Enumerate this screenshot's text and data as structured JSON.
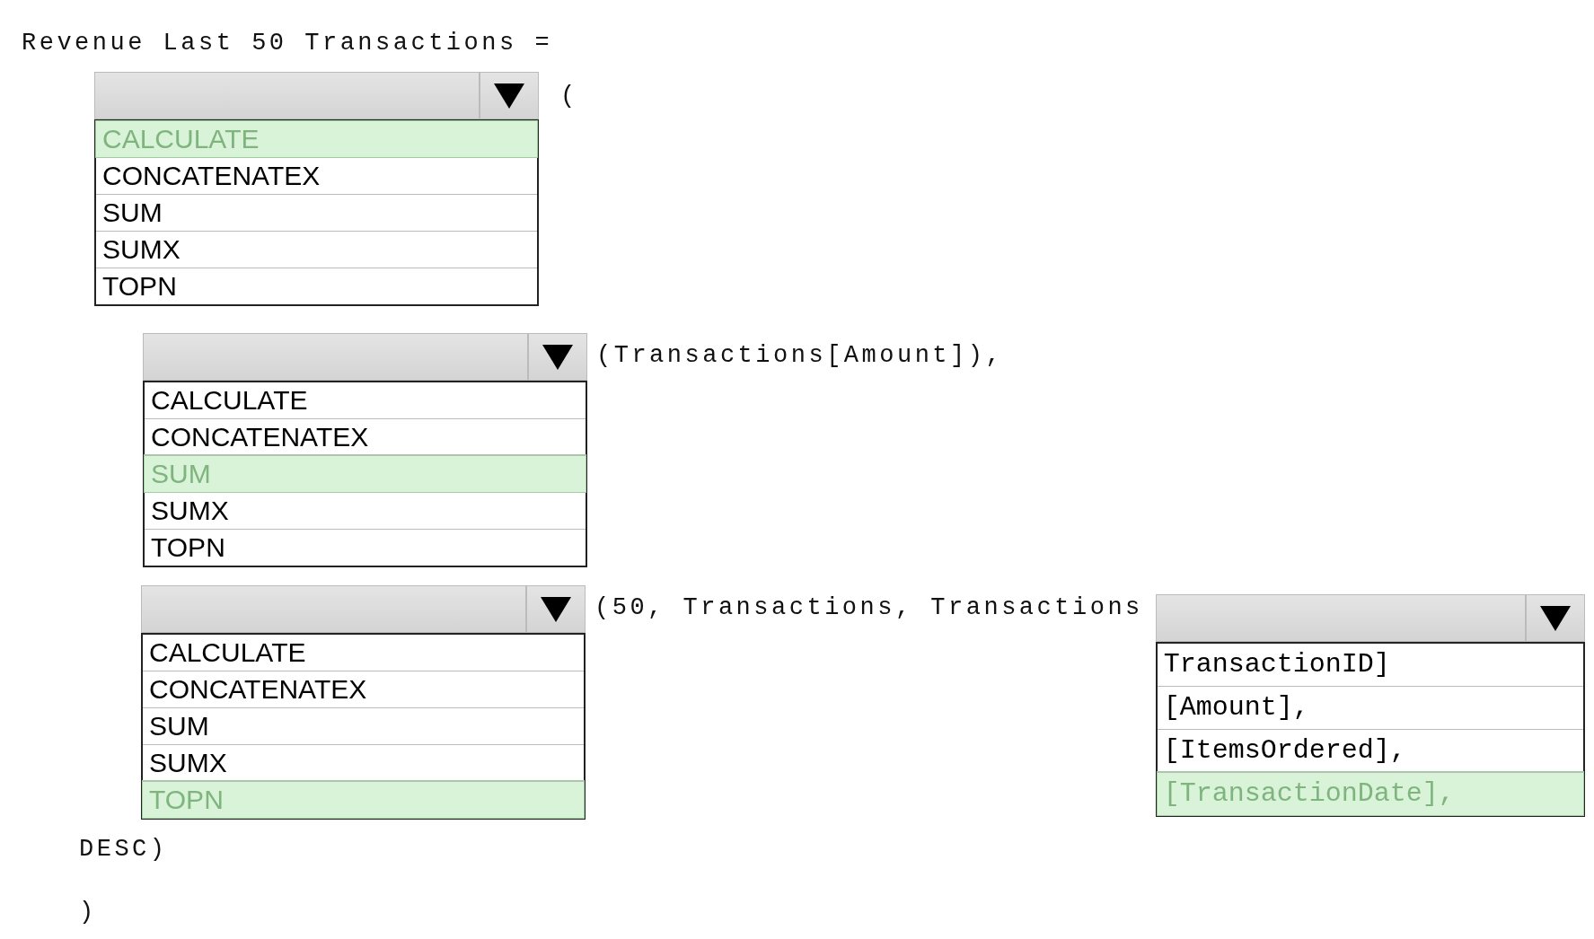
{
  "title": "Revenue Last 50 Transactions =",
  "dropdowns": [
    {
      "kind": "function",
      "suffix": "(",
      "options": [
        {
          "label": "CALCULATE",
          "selected": true
        },
        {
          "label": "CONCATENATEX",
          "selected": false
        },
        {
          "label": "SUM",
          "selected": false
        },
        {
          "label": "SUMX",
          "selected": false
        },
        {
          "label": "TOPN",
          "selected": false
        }
      ]
    },
    {
      "kind": "function",
      "suffix": "(Transactions[Amount]),",
      "options": [
        {
          "label": "CALCULATE",
          "selected": false
        },
        {
          "label": "CONCATENATEX",
          "selected": false
        },
        {
          "label": "SUM",
          "selected": true
        },
        {
          "label": "SUMX",
          "selected": false
        },
        {
          "label": "TOPN",
          "selected": false
        }
      ]
    },
    {
      "kind": "function",
      "suffix": "(50, Transactions, Transactions",
      "options": [
        {
          "label": "CALCULATE",
          "selected": false
        },
        {
          "label": "CONCATENATEX",
          "selected": false
        },
        {
          "label": "SUM",
          "selected": false
        },
        {
          "label": "SUMX",
          "selected": false
        },
        {
          "label": "TOPN",
          "selected": true
        }
      ]
    },
    {
      "kind": "column",
      "options": [
        {
          "label": "TransactionID]",
          "selected": false
        },
        {
          "label": "[Amount],",
          "selected": false
        },
        {
          "label": "[ItemsOrdered],",
          "selected": false
        },
        {
          "label": "[TransactionDate],",
          "selected": true
        }
      ]
    }
  ],
  "closing_lines": [
    "DESC)",
    ")"
  ]
}
